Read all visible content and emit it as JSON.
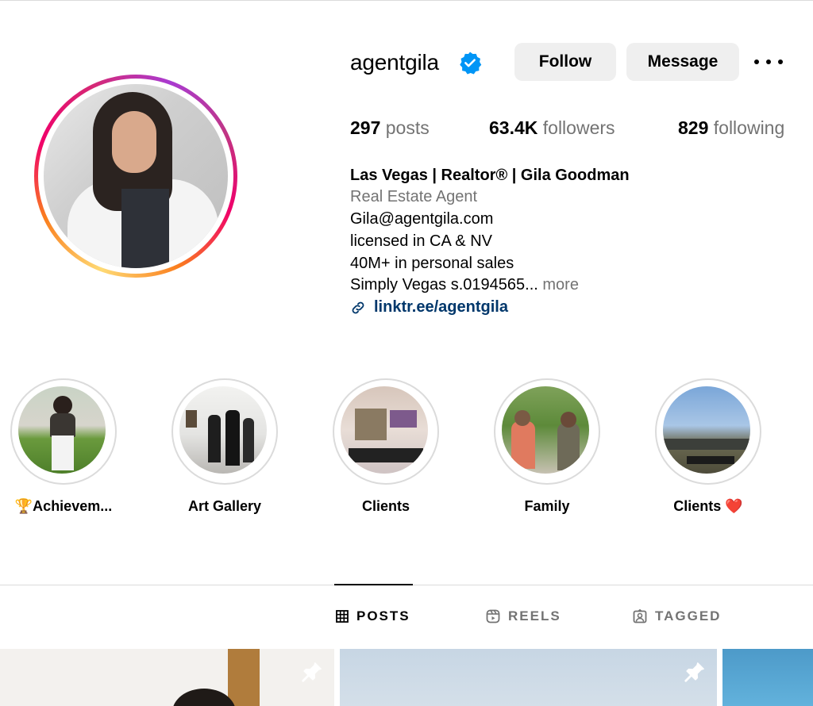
{
  "profile": {
    "username": "agentgila",
    "verified_icon": "verified-badge-icon",
    "follow_label": "Follow",
    "message_label": "Message",
    "more_icon": "more-options-icon"
  },
  "stats": {
    "posts_count": "297",
    "posts_label": "posts",
    "followers_count": "63.4K",
    "followers_label": "followers",
    "following_count": "829",
    "following_label": "following"
  },
  "bio": {
    "name": "Las Vegas | Realtor® | Gila Goodman",
    "category": "Real Estate Agent",
    "lines": [
      "Gila@agentgila.com",
      "licensed in CA & NV",
      "40M+ in personal sales"
    ],
    "truncated_line": "Simply Vegas s.0194565...",
    "more_label": "more",
    "link_text": "linktr.ee/agentgila"
  },
  "highlights": [
    {
      "label": "🏆Achievem..."
    },
    {
      "label": "Art Gallery"
    },
    {
      "label": "Clients"
    },
    {
      "label": "Family"
    },
    {
      "label": "Clients ❤️"
    }
  ],
  "tabs": [
    {
      "label": "POSTS",
      "icon": "grid-icon",
      "active": true
    },
    {
      "label": "REELS",
      "icon": "reels-icon",
      "active": false
    },
    {
      "label": "TAGGED",
      "icon": "tagged-icon",
      "active": false
    }
  ],
  "colors": {
    "link": "#00376b",
    "verified": "#0095f6",
    "muted": "#737373",
    "button_bg": "#efefef"
  }
}
